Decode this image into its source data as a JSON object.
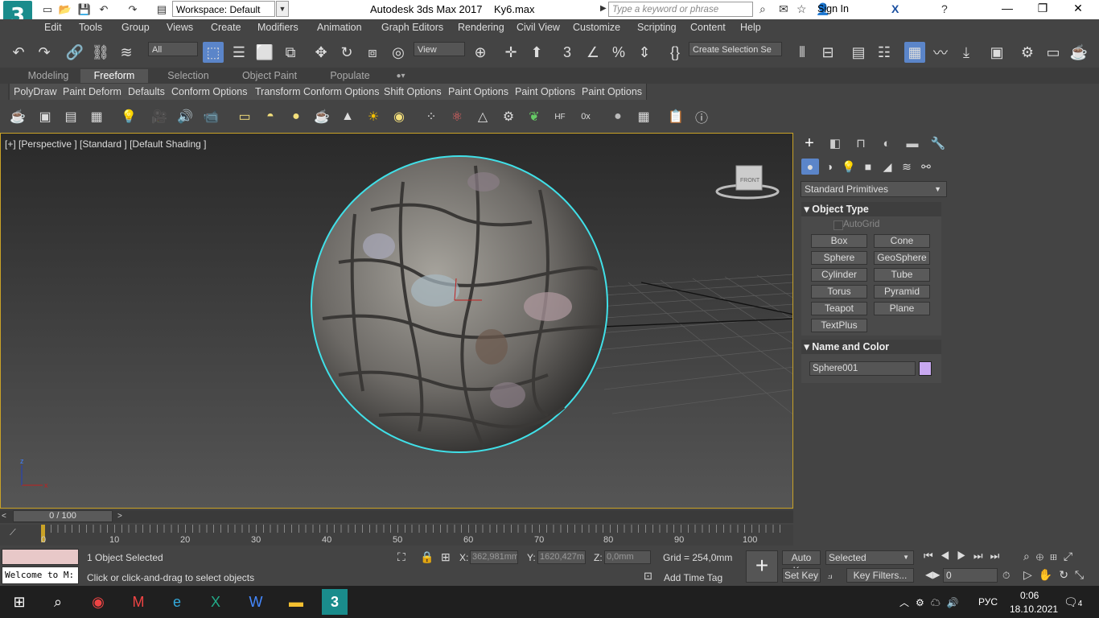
{
  "titlebar": {
    "logo_text": "3",
    "workspace": "Workspace: Default",
    "app_title": "Autodesk 3ds Max 2017",
    "file_name": "Ky6.max",
    "search_placeholder": "Type a keyword or phrase",
    "sign_in": "Sign In"
  },
  "menu": [
    "Edit",
    "Tools",
    "Group",
    "Views",
    "Create",
    "Modifiers",
    "Animation",
    "Graph Editors",
    "Rendering",
    "Civil View",
    "Customize",
    "Scripting",
    "Content",
    "Help"
  ],
  "toolbar": {
    "filter": "All",
    "ref_coord": "View",
    "selection_set": "Create Selection Se"
  },
  "ribbon": {
    "tabs": [
      "Modeling",
      "Freeform",
      "Selection",
      "Object Paint",
      "Populate"
    ],
    "buttons": [
      "PolyDraw",
      "Paint Deform",
      "Defaults",
      "Conform Options",
      "Transform Conform Options",
      "Shift Options",
      "Paint Options",
      "Paint Options",
      "Paint Options"
    ]
  },
  "viewport": {
    "label": "[+] [Perspective ] [Standard ] [Default Shading ]",
    "viewcube_face": "FRONT"
  },
  "command_panel": {
    "category": "Standard Primitives",
    "object_type_title": "Object Type",
    "autogrid": "AutoGrid",
    "buttons": [
      "Box",
      "Cone",
      "Sphere",
      "GeoSphere",
      "Cylinder",
      "Tube",
      "Torus",
      "Pyramid",
      "Teapot",
      "Plane",
      "TextPlus"
    ],
    "name_color_title": "Name and Color",
    "object_name": "Sphere001",
    "object_color": "#c8a8f0"
  },
  "timeline": {
    "frame": "0 / 100",
    "ticks": [
      "0",
      "10",
      "20",
      "30",
      "40",
      "50",
      "60",
      "70",
      "80",
      "90",
      "100"
    ]
  },
  "status": {
    "maxscript": "Welcome to M:",
    "selected": "1 Object Selected",
    "prompt": "Click or click-and-drag to select objects",
    "x_label": "X:",
    "x_value": "362,981mm",
    "y_label": "Y:",
    "y_value": "1620,427m",
    "z_label": "Z:",
    "z_value": "0,0mm",
    "grid": "Grid = 254,0mm",
    "add_time_tag": "Add Time Tag",
    "auto_key": "Auto Key",
    "set_key": "Set Key",
    "selected_dd": "Selected",
    "key_filters": "Key Filters...",
    "frame_field": "0"
  },
  "taskbar": {
    "lang": "РУС",
    "time": "0:06",
    "date": "18.10.2021",
    "notifications": "4"
  },
  "colors": {
    "accent": "#1a8c8c",
    "selection": "#40e0e8",
    "viewport_border": "#c9a227"
  }
}
